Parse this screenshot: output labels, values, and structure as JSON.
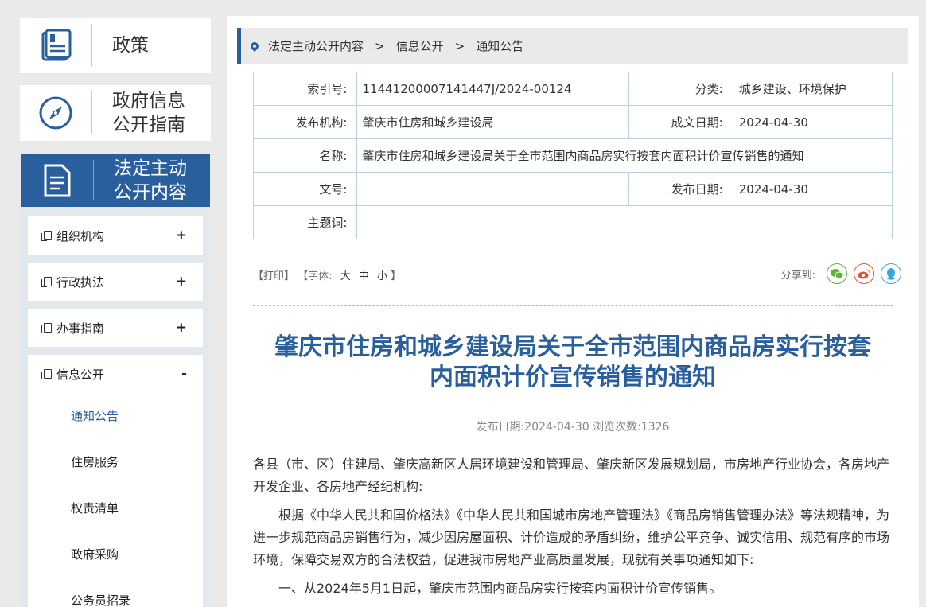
{
  "sidebar": {
    "cards": [
      {
        "label": "政策",
        "icon": "policy-book-icon"
      },
      {
        "label_line1": "政府信息",
        "label_line2": "公开指南",
        "icon": "compass-icon"
      },
      {
        "label_line1": "法定主动",
        "label_line2": "公开内容",
        "icon": "document-icon"
      }
    ],
    "menu": [
      {
        "label": "组织机构",
        "toggle": "+"
      },
      {
        "label": "行政执法",
        "toggle": "+"
      },
      {
        "label": "办事指南",
        "toggle": "+"
      },
      {
        "label": "信息公开",
        "toggle": "-"
      }
    ],
    "submenu": [
      "通知公告",
      "住房服务",
      "权责清单",
      "政府采购",
      "公务员招录"
    ]
  },
  "breadcrumb": {
    "items": [
      "法定主动公开内容",
      "信息公开",
      "通知公告"
    ],
    "separator": ">"
  },
  "meta": {
    "index_key": "索引号:",
    "index_val": "11441200007141447J/2024-00124",
    "category_key": "分类:",
    "category_val": "城乡建设、环境保护",
    "publisher_key": "发布机构:",
    "publisher_val": "肇庆市住房和城乡建设局",
    "created_key": "成文日期:",
    "created_val": "2024-04-30",
    "name_key": "名称:",
    "name_val": "肇庆市住房和城乡建设局关于全市范围内商品房实行按套内面积计价宣传销售的通知",
    "docno_key": "文号:",
    "docno_val": "",
    "pubdate_key": "发布日期:",
    "pubdate_val": "2024-04-30",
    "subject_key": "主题词:",
    "subject_val": ""
  },
  "tools": {
    "print": "【打印】",
    "font_prefix": "【字体:",
    "font_large": "大",
    "font_mid": "中",
    "font_small": "小",
    "font_suffix": "】",
    "share_label": "分享到:",
    "share_icons": [
      "wechat-icon",
      "weibo-icon",
      "qq-icon"
    ],
    "share_colors": [
      "#5fb236",
      "#e6552f",
      "#3aa6e0"
    ]
  },
  "article": {
    "title_line1": "肇庆市住房和城乡建设局关于全市范围内商品房实行按套",
    "title_line2": "内面积计价宣传销售的通知",
    "info": "发布日期:2024-04-30  浏览次数:1326",
    "para1": "各县（市、区）住建局、肇庆高新区人居环境建设和管理局、肇庆新区发展规划局，市房地产行业协会，各房地产开发企业、各房地产经纪机构:",
    "para2": "根据《中华人民共和国价格法》《中华人民共和国城市房地产管理法》《商品房销售管理办法》等法规精神，为进一步规范商品房销售行为，减少因房屋面积、计价造成的矛盾纠纷，维护公平竞争、诚实信用、规范有序的市场环境，保障交易双方的合法权益，促进我市房地产业高质量发展，现就有关事项通知如下:",
    "para3": "一、从2024年5月1日起，肇庆市范围内商品房实行按套内面积计价宣传销售。"
  },
  "colors": {
    "accent": "#2a5f9e",
    "background": "#eaeaea"
  }
}
